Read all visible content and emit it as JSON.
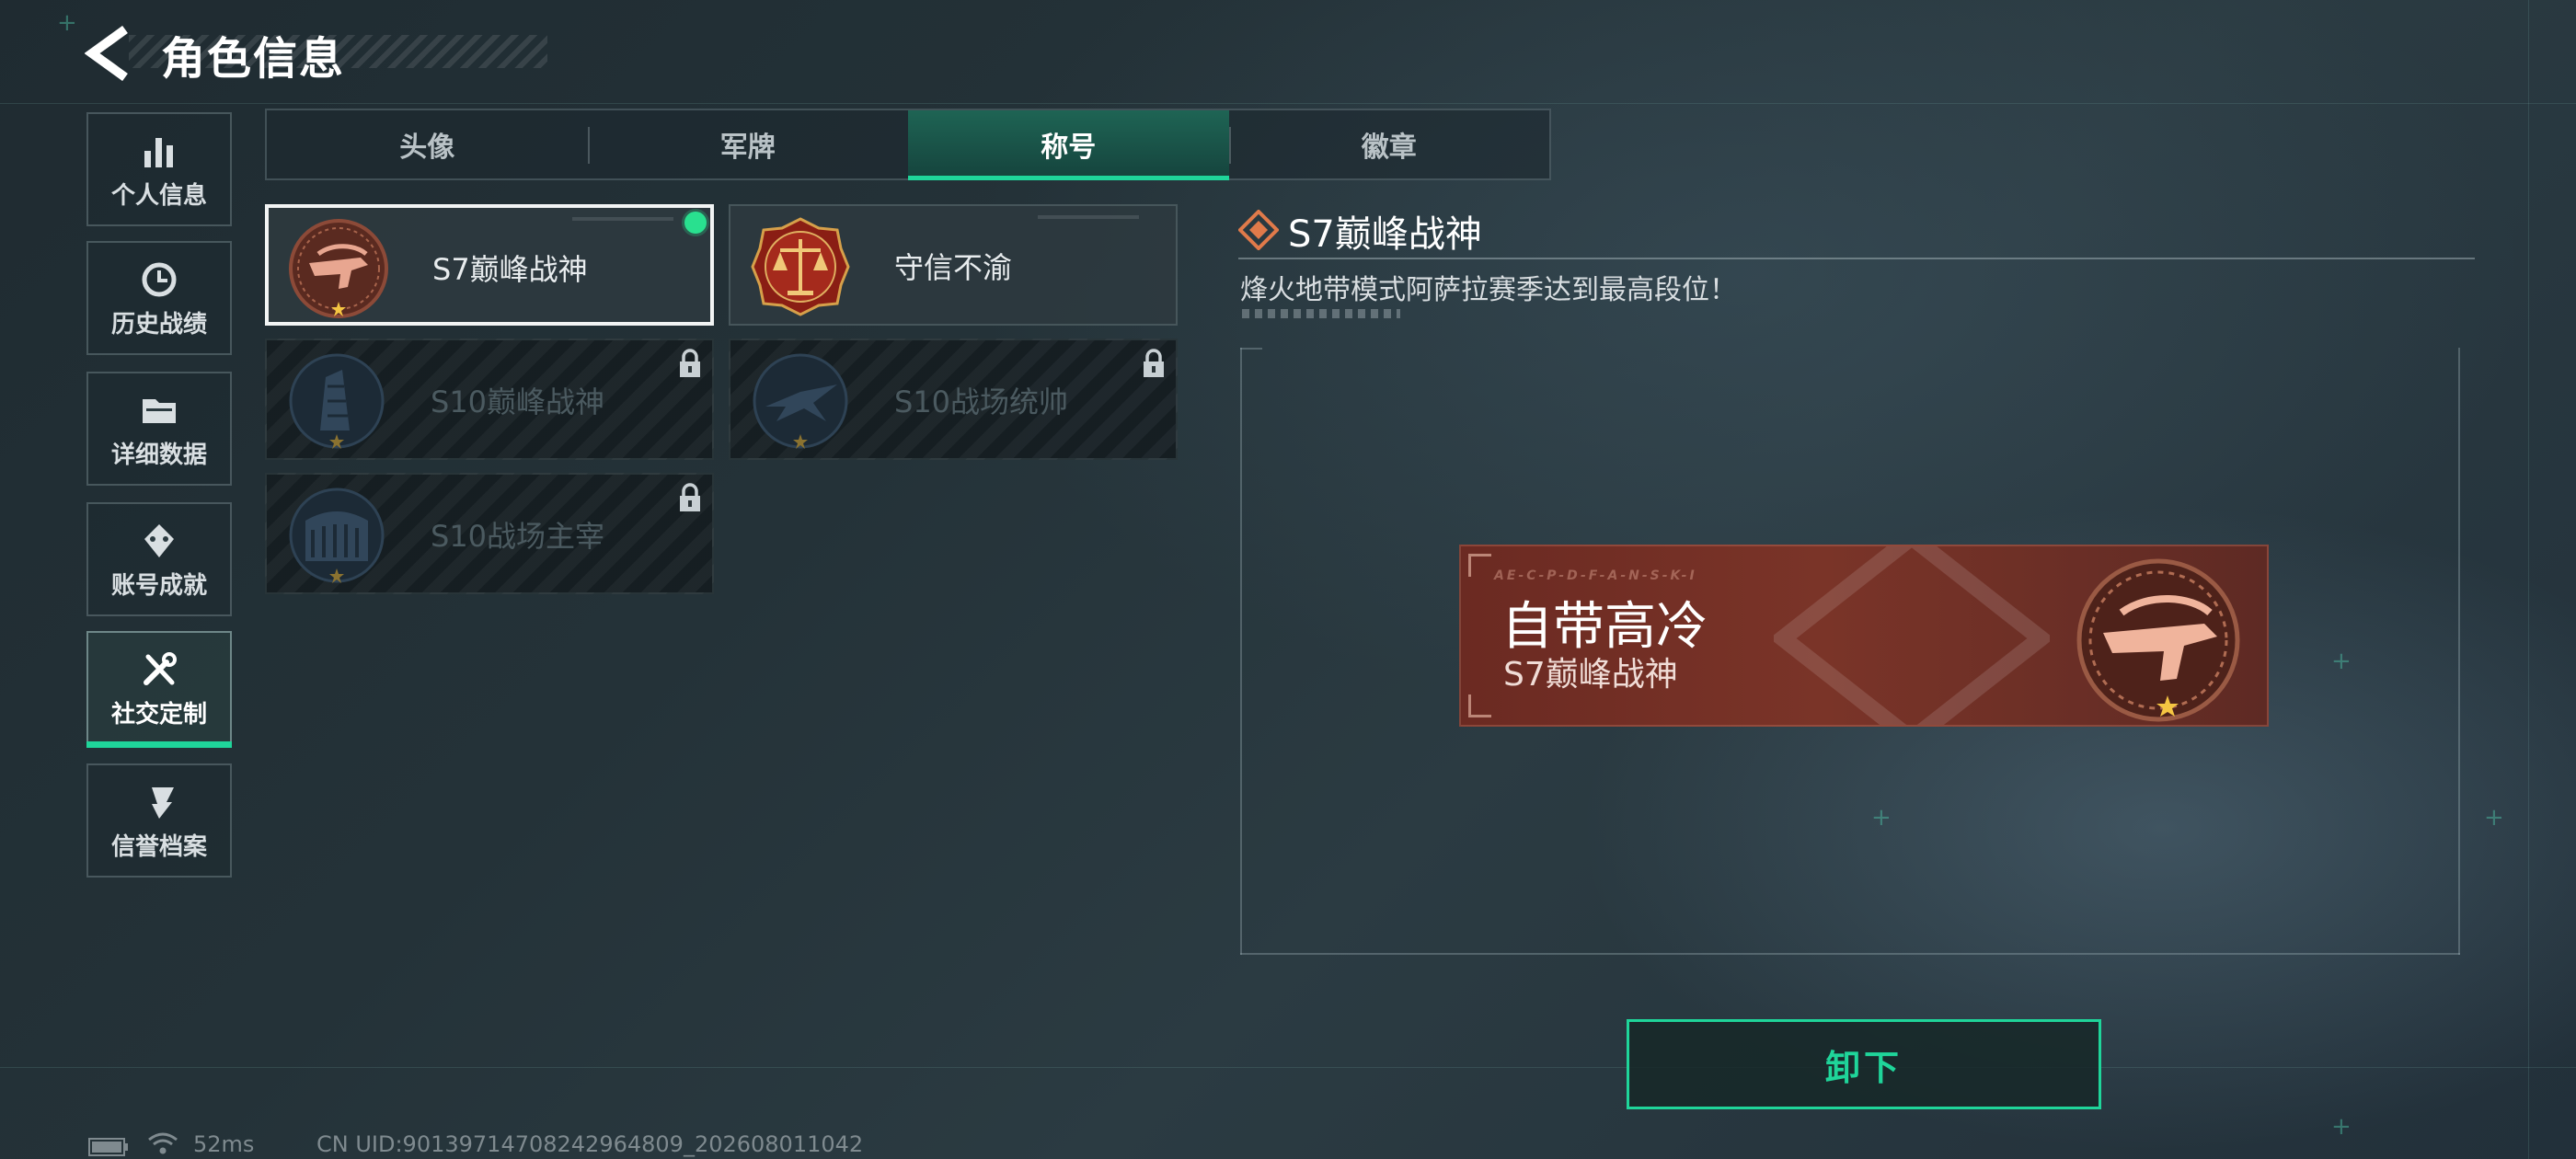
{
  "header": {
    "title": "角色信息"
  },
  "sidebar": {
    "items": [
      {
        "label": "个人信息",
        "icon": "bar-chart-icon"
      },
      {
        "label": "历史战绩",
        "icon": "history-icon"
      },
      {
        "label": "详细数据",
        "icon": "folder-icon"
      },
      {
        "label": "账号成就",
        "icon": "achievement-icon"
      },
      {
        "label": "社交定制",
        "icon": "tools-icon",
        "active": true
      },
      {
        "label": "信誉档案",
        "icon": "credit-icon"
      }
    ]
  },
  "tabs": [
    {
      "label": "头像"
    },
    {
      "label": "军牌"
    },
    {
      "label": "称号",
      "active": true
    },
    {
      "label": "徽章"
    }
  ],
  "titles": [
    {
      "name": "S7巅峰战神",
      "locked": false,
      "selected": true,
      "equipped": true
    },
    {
      "name": "守信不渝",
      "locked": false
    },
    {
      "name": "S10巅峰战神",
      "locked": true
    },
    {
      "name": "S10战场统帅",
      "locked": true
    },
    {
      "name": "S10战场主宰",
      "locked": true
    }
  ],
  "detail": {
    "title": "S7巅峰战神",
    "description": "烽火地带模式阿萨拉赛季达到最高段位！"
  },
  "preview": {
    "title": "自带高冷",
    "subtitle": "S7巅峰战神",
    "micro_text": "AE-C-P-D-F-A-N-S-K-I"
  },
  "actions": {
    "unequip_label": "卸下"
  },
  "status_bar": {
    "ping": "52ms",
    "uid": "CN UID:9013971470824296480­9_202608011042"
  },
  "colors": {
    "accent": "#1fd59a",
    "banner": "#7a3428",
    "equipped_dot": "#29e08f"
  }
}
